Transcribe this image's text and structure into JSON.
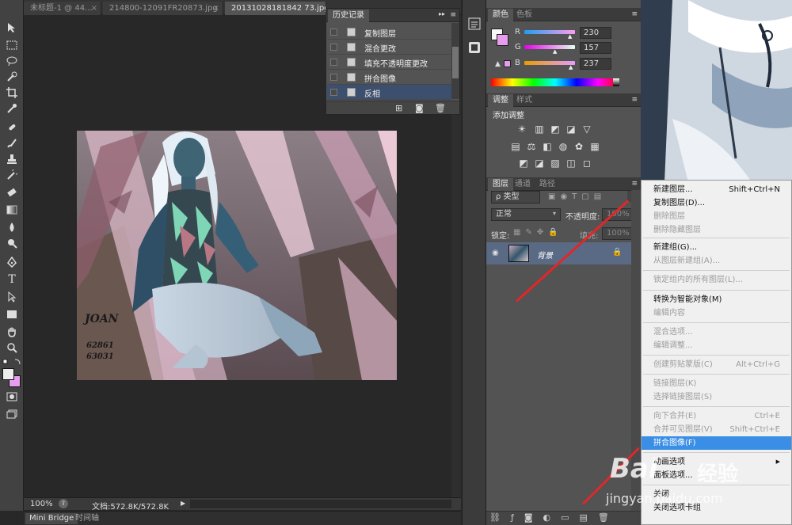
{
  "doc_tabs": [
    {
      "label": "未标题-1 @ 44...",
      "active": false
    },
    {
      "label": "214800-12091FR20873.jpg",
      "active": false
    },
    {
      "label": "20131028181842 73.jpg @ 100%(RGB/8#)",
      "active": true
    }
  ],
  "doc_tab_close": "×",
  "history_panel": {
    "tab": "历史记录",
    "menu_glyph": "▸▸",
    "items": [
      "复制图层",
      "混合更改",
      "填充不透明度更改",
      "拼合图像",
      "反相"
    ]
  },
  "color_panel": {
    "tabs": [
      "颜色",
      "色板"
    ],
    "channels": [
      {
        "label": "R",
        "value": "230"
      },
      {
        "label": "G",
        "value": "157"
      },
      {
        "label": "B",
        "value": "237"
      }
    ],
    "foreground_color": "#ffffff",
    "background_color": "#e69ded"
  },
  "adjustments_panel": {
    "tabs": [
      "调整",
      "样式"
    ],
    "title": "添加调整",
    "row1": [
      "☀",
      "▥",
      "◩",
      "◪",
      "▽"
    ],
    "row2": [
      "▤",
      "⚖",
      "◧",
      "◍",
      "✿",
      "▦"
    ],
    "row3": [
      "◩",
      "◪",
      "▨",
      "◫"
    ]
  },
  "layers_panel": {
    "tabs": [
      "图层",
      "通道",
      "路径"
    ],
    "filter_label": "ρ 类型",
    "blend_mode": "正常",
    "opacity_label": "不透明度:",
    "opacity_value": "100%",
    "lock_label": "锁定:",
    "fill_label": "填充:",
    "fill_value": "100%",
    "layer_name": "背景"
  },
  "context_menu": {
    "items": [
      {
        "label": "新建图层...",
        "shortcut": "Shift+Ctrl+N",
        "disabled": false
      },
      {
        "label": "复制图层(D)...",
        "shortcut": "",
        "disabled": false
      },
      {
        "label": "删除图层",
        "shortcut": "",
        "disabled": true
      },
      {
        "label": "删除隐藏图层",
        "shortcut": "",
        "disabled": true
      },
      {
        "label": "新建组(G)...",
        "shortcut": "",
        "disabled": false
      },
      {
        "label": "从图层新建组(A)...",
        "shortcut": "",
        "disabled": true
      },
      {
        "label": "锁定组内的所有图层(L)...",
        "shortcut": "",
        "disabled": true
      },
      {
        "label": "转换为智能对象(M)",
        "shortcut": "",
        "disabled": false
      },
      {
        "label": "编辑内容",
        "shortcut": "",
        "disabled": true
      },
      {
        "label": "混合选项...",
        "shortcut": "",
        "disabled": true
      },
      {
        "label": "编辑调整...",
        "shortcut": "",
        "disabled": true
      },
      {
        "label": "创建剪贴蒙版(C)",
        "shortcut": "Alt+Ctrl+G",
        "disabled": true
      },
      {
        "label": "链接图层(K)",
        "shortcut": "",
        "disabled": true
      },
      {
        "label": "选择链接图层(S)",
        "shortcut": "",
        "disabled": true
      },
      {
        "label": "向下合并(E)",
        "shortcut": "Ctrl+E",
        "disabled": true
      },
      {
        "label": "合并可见图层(V)",
        "shortcut": "Shift+Ctrl+E",
        "disabled": true
      },
      {
        "label": "拼合图像(F)",
        "shortcut": "",
        "disabled": false
      },
      {
        "label": "动画选项",
        "shortcut": "",
        "disabled": false
      },
      {
        "label": "面板选项...",
        "shortcut": "",
        "disabled": false
      },
      {
        "label": "关闭",
        "shortcut": "",
        "disabled": false
      },
      {
        "label": "关闭选项卡组",
        "shortcut": "",
        "disabled": false
      }
    ],
    "submenu_arrow": "▶"
  },
  "status": {
    "zoom": "100%",
    "doc_info": "文档:572.8K/572.8K",
    "arrow": "▶"
  },
  "bottom_tabs": [
    "Mini Bridge",
    "时间轴"
  ],
  "photo": {
    "name_text": "JOAN",
    "num1": "62861",
    "num2": "63031"
  },
  "watermark": {
    "brand": "Bai",
    "brand_cn": "经验",
    "url": "jingyan.baidu.com"
  },
  "colors": {
    "accent_selected": "#3d4f6e",
    "menu_highlight": "#3a8ee6",
    "annotation_arrow": "#e0272a"
  }
}
